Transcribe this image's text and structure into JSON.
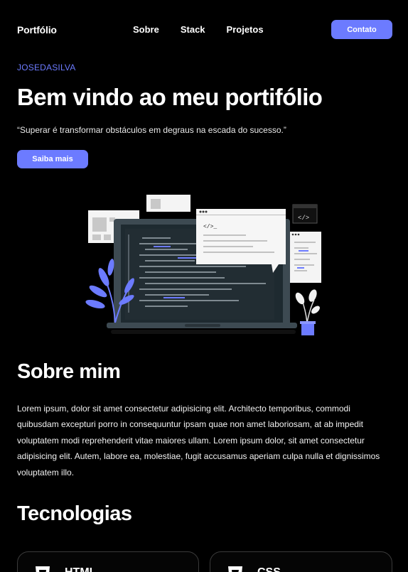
{
  "nav": {
    "logo": "Portfólio",
    "links": [
      "Sobre",
      "Stack",
      "Projetos"
    ],
    "cta_label": "Contato"
  },
  "hero": {
    "eyebrow": "JOSEDASILVA",
    "title": "Bem vindo ao meu portifólio",
    "quote": "“Superar é transformar obstáculos em degraus na escada do sucesso.”",
    "button_label": "Saiba mais",
    "code_tag": "</>_",
    "code_tag_small": "</>"
  },
  "about": {
    "title": "Sobre mim",
    "text": "Lorem ipsum, dolor sit amet consectetur adipisicing elit. Architecto temporibus, commodi quibusdam excepturi porro in consequuntur ipsam quae non amet laboriosam, at ab impedit voluptatem modi reprehenderit vitae maiores ullam. Lorem ipsum dolor, sit amet consectetur adipisicing elit. Autem, labore ea, molestiae, fugit accusamus aperiam culpa nulla et dignissimos voluptatem illo."
  },
  "tech": {
    "title": "Tecnologias",
    "cards": [
      {
        "name": "HTML",
        "icon": "html5-icon"
      },
      {
        "name": "CSS",
        "icon": "css3-icon"
      }
    ]
  },
  "colors": {
    "accent": "#6c7bff",
    "background": "#000000"
  }
}
